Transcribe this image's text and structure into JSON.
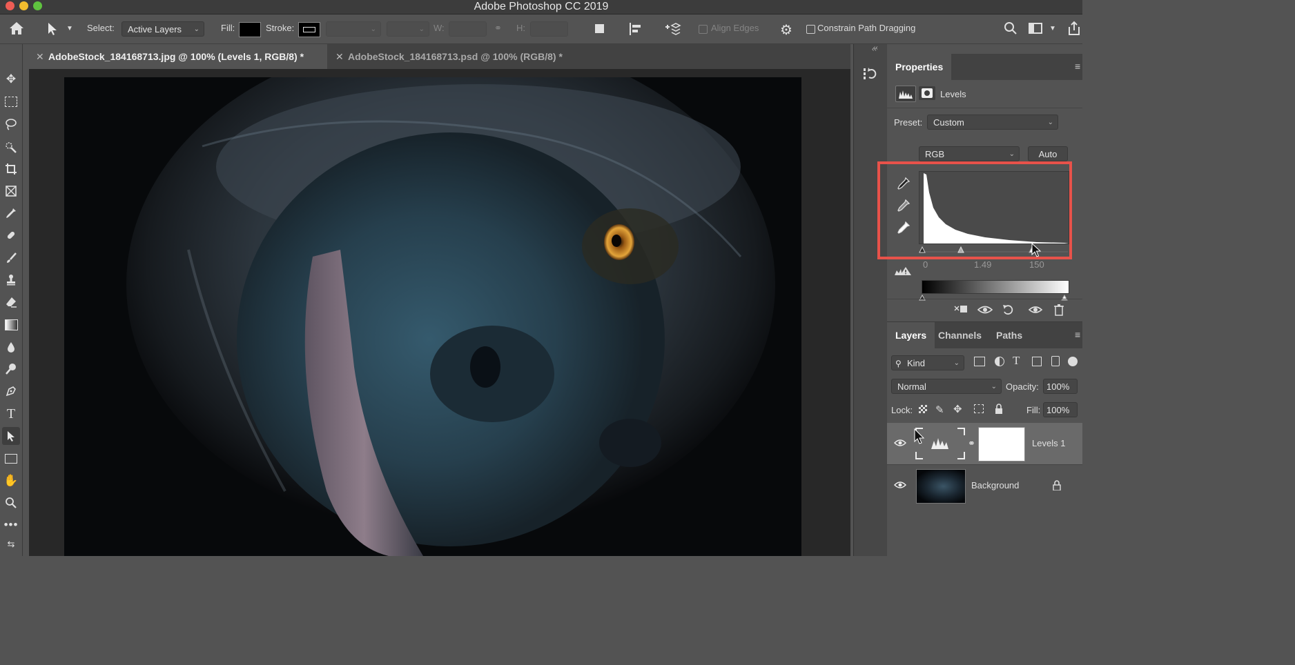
{
  "app": {
    "title": "Adobe Photoshop CC 2019"
  },
  "options": {
    "select_label": "Select:",
    "select_value": "Active Layers",
    "fill_label": "Fill:",
    "stroke_label": "Stroke:",
    "w_label": "W:",
    "h_label": "H:",
    "align_edges": "Align Edges",
    "constrain": "Constrain Path Dragging"
  },
  "tabs": [
    {
      "label": "AdobeStock_184168713.jpg @ 100% (Levels 1, RGB/8) *",
      "active": true
    },
    {
      "label": "AdobeStock_184168713.psd @ 100% (RGB/8) *",
      "active": false
    }
  ],
  "properties": {
    "tab": "Properties",
    "adjustment": "Levels",
    "preset_label": "Preset:",
    "preset_value": "Custom",
    "channel": "RGB",
    "auto": "Auto",
    "input_values": [
      "0",
      "1.49",
      "150"
    ]
  },
  "layers": {
    "tabs": [
      "Layers",
      "Channels",
      "Paths"
    ],
    "kind": "Kind",
    "blend": "Normal",
    "opacity_label": "Opacity:",
    "opacity": "100%",
    "lock_label": "Lock:",
    "fill_label": "Fill:",
    "fill": "100%",
    "items": [
      {
        "name": "Levels 1"
      },
      {
        "name": "Background"
      }
    ]
  },
  "colors": {
    "highlight": "#e8524a",
    "panel": "#535353",
    "dark": "#424242"
  }
}
